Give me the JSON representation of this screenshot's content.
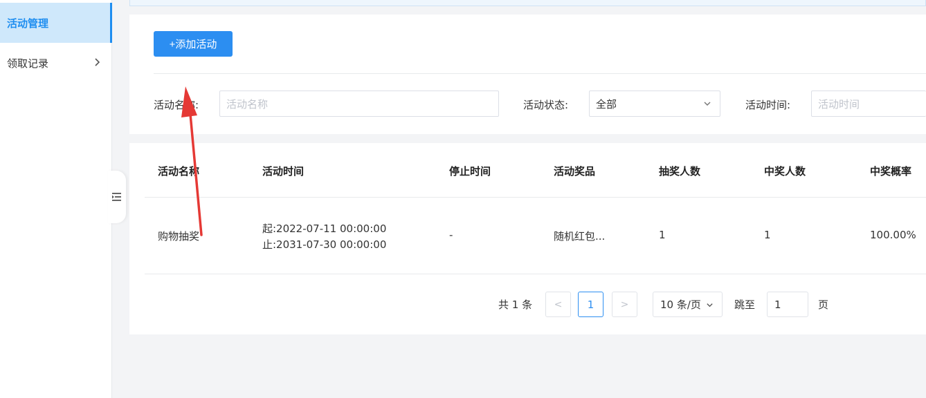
{
  "sidebar": {
    "items": [
      {
        "label": "活动管理",
        "active": true
      },
      {
        "label": "领取记录",
        "active": false
      }
    ]
  },
  "toolbar": {
    "add_label": "+添加活动"
  },
  "filters": {
    "name_label": "活动名称:",
    "name_placeholder": "活动名称",
    "status_label": "活动状态:",
    "status_value": "全部",
    "time_label": "活动时间:",
    "time_placeholder": "活动时间"
  },
  "table": {
    "columns": [
      "活动名称",
      "活动时间",
      "停止时间",
      "活动奖品",
      "抽奖人数",
      "中奖人数",
      "中奖概率"
    ],
    "rows": [
      {
        "name": "购物抽奖",
        "start": "起:2022-07-11 00:00:00",
        "end": "止:2031-07-30 00:00:00",
        "stop_time": "-",
        "prize": "随机红包...",
        "draw_count": "1",
        "win_count": "1",
        "win_rate": "100.00%"
      }
    ]
  },
  "pagination": {
    "total_text": "共 1 条",
    "prev": "<",
    "current_page": "1",
    "next": ">",
    "page_size": "10 条/页",
    "jump_label": "跳至",
    "jump_value": "1",
    "page_suffix": "页"
  },
  "colors": {
    "accent": "#2c8ef1",
    "annotation": "#e53935"
  },
  "icons": {
    "sidebar_chevron": "chevron-right-icon",
    "collapse": "menu-fold-icon",
    "select_arrow": "chevron-down-icon"
  }
}
